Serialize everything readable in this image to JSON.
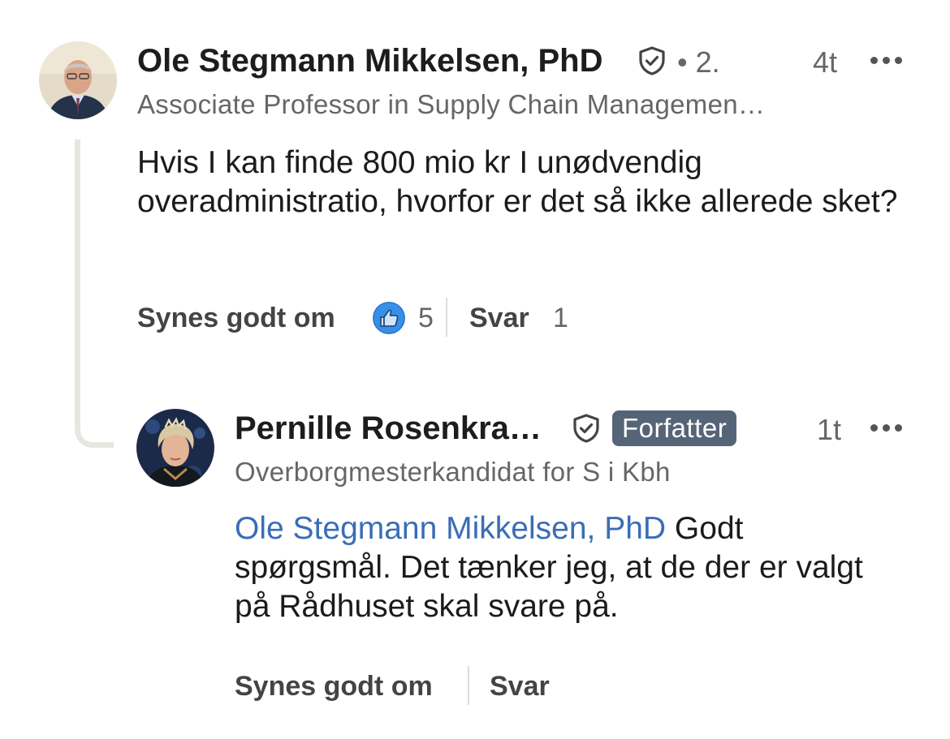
{
  "comments": [
    {
      "author": "Ole Stegmann Mikkelsen, PhD",
      "degree": "• 2.",
      "time": "4t",
      "headline": "Associate Professor in Supply Chain Managemen…",
      "text": "Hvis I kan finde 800 mio kr I unødvendig overadministratio, hvorfor er det så ikke allerede sket?",
      "like_label": "Synes godt om",
      "reaction_count": "5",
      "reply_label": "Svar",
      "reply_count": "1"
    }
  ],
  "reply": {
    "author": "Pernille Rosenkra…",
    "badge": "Forfatter",
    "time": "1t",
    "headline": "Overborgmesterkandidat for S i Kbh",
    "mention": "Ole Stegmann Mikkelsen, PhD",
    "text": " Godt spørgsmål. Det tænker jeg, at de der er valgt på Rådhuset skal svare på.",
    "like_label": "Synes godt om",
    "reply_label": "Svar"
  },
  "icons": {
    "verified": "shield-check-icon",
    "more": "more-horizontal-icon",
    "reaction": "like-thumb-icon"
  },
  "colors": {
    "mention": "#3a6db6",
    "badge_bg": "#566477",
    "reaction_blue": "#378fe9"
  }
}
